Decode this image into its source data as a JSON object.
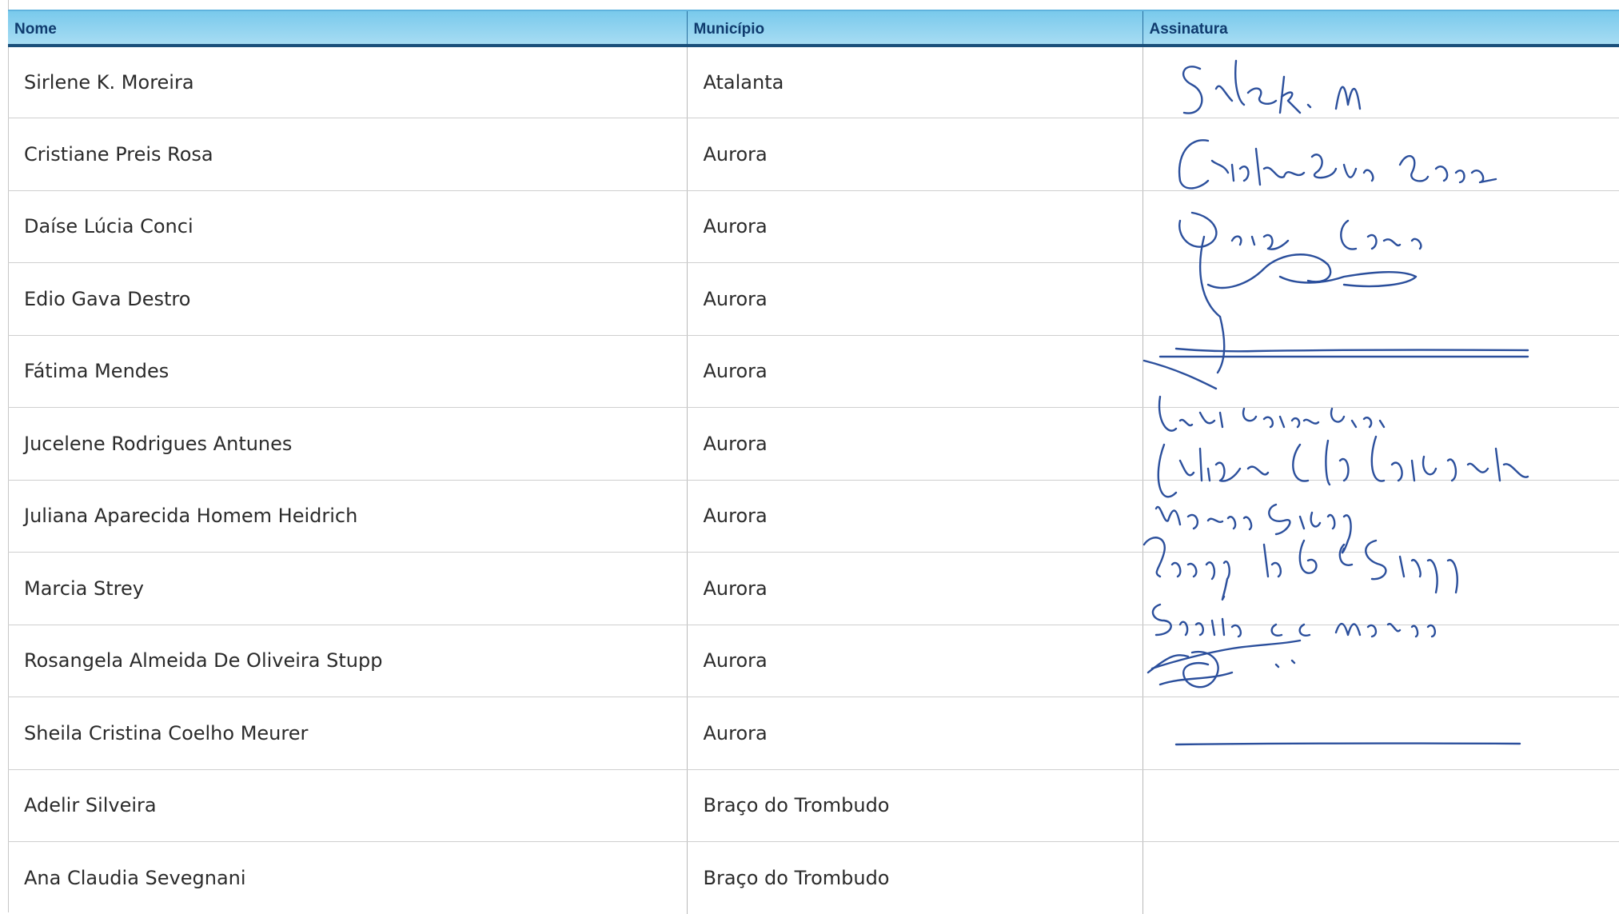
{
  "table": {
    "headers": {
      "name": "Nome",
      "municipality": "Município",
      "signature": "Assinatura"
    },
    "rows": [
      {
        "name": "Sirlene K. Moreira",
        "municipality": "Atalanta"
      },
      {
        "name": "Cristiane Preis Rosa",
        "municipality": "Aurora"
      },
      {
        "name": "Daíse Lúcia Conci",
        "municipality": "Aurora"
      },
      {
        "name": "Edio Gava Destro",
        "municipality": "Aurora"
      },
      {
        "name": "Fátima Mendes",
        "municipality": "Aurora"
      },
      {
        "name": "Jucelene Rodrigues Antunes",
        "municipality": "Aurora"
      },
      {
        "name": "Juliana Aparecida Homem Heidrich",
        "municipality": "Aurora"
      },
      {
        "name": "Marcia Strey",
        "municipality": "Aurora"
      },
      {
        "name": "Rosangela Almeida De Oliveira Stupp",
        "municipality": "Aurora"
      },
      {
        "name": "Sheila Cristina Coelho Meurer",
        "municipality": "Aurora"
      },
      {
        "name": "Adelir Silveira",
        "municipality": "Braço do Trombudo"
      },
      {
        "name": "Ana Claudia Sevegnani",
        "municipality": "Braço do Trombudo"
      }
    ],
    "signatures": [
      "Sirlene K. M.",
      "Cristiane Preis Rosa",
      "Daise Conci",
      "",
      "",
      "Jucelene Rodrigues Antunes",
      "Juliana A. H. Heidrich",
      "Marcia Strey",
      "Rosângela A. de O. Stupp",
      "Sheila C. C. Meurer",
      "",
      ""
    ]
  },
  "colors": {
    "header_bg": "#8fd3f0",
    "header_text": "#0f3b6e",
    "ink": "#2b4f9c"
  }
}
